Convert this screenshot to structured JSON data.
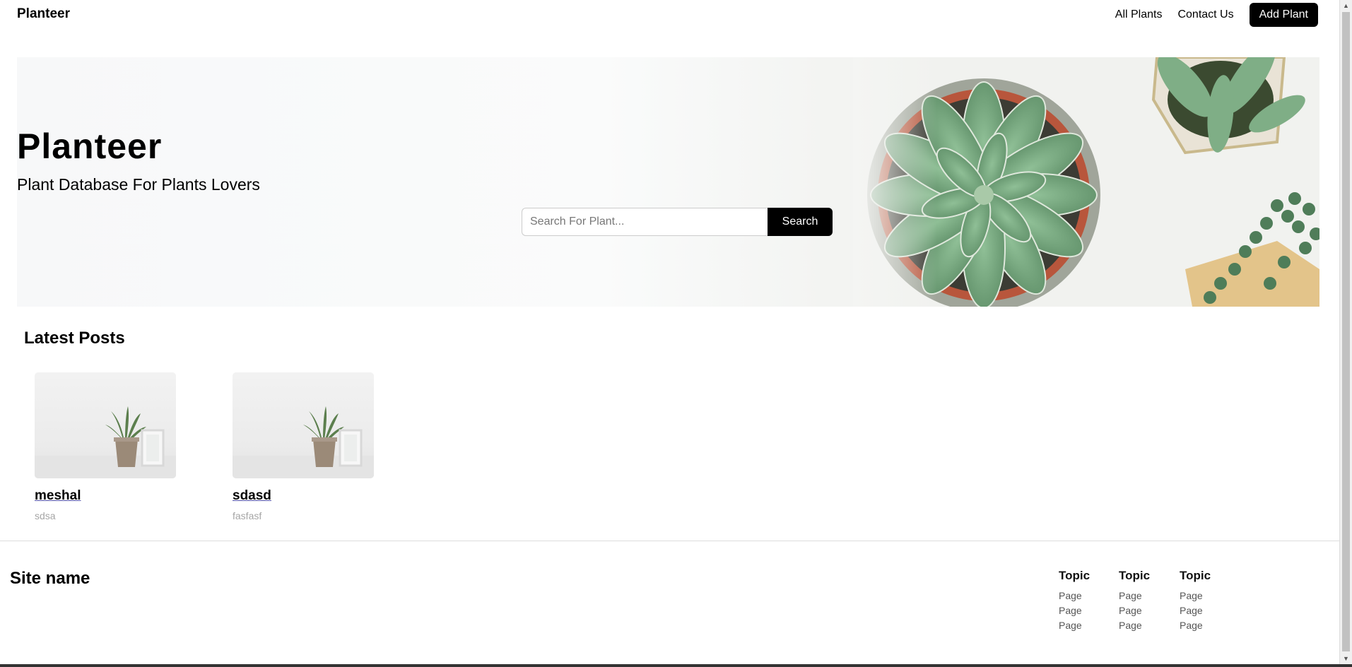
{
  "header": {
    "brand": "Planteer",
    "links": [
      "All Plants",
      "Contact Us"
    ],
    "cta": "Add Plant"
  },
  "hero": {
    "title": "Planteer",
    "subtitle": "Plant Database For Plants Lovers",
    "search_placeholder": "Search For Plant...",
    "search_button": "Search"
  },
  "latest": {
    "heading": "Latest Posts",
    "posts": [
      {
        "title": "meshal",
        "subtitle": "sdsa"
      },
      {
        "title": "sdasd",
        "subtitle": "fasfasf"
      }
    ]
  },
  "footer": {
    "site_name": "Site name",
    "columns": [
      {
        "topic": "Topic",
        "pages": [
          "Page",
          "Page",
          "Page"
        ]
      },
      {
        "topic": "Topic",
        "pages": [
          "Page",
          "Page",
          "Page"
        ]
      },
      {
        "topic": "Topic",
        "pages": [
          "Page",
          "Page",
          "Page"
        ]
      }
    ]
  },
  "colors": {
    "primary": "#000000",
    "muted_text": "#a5a5a5",
    "divider": "#dddddd",
    "succulent": "#7aa883"
  }
}
